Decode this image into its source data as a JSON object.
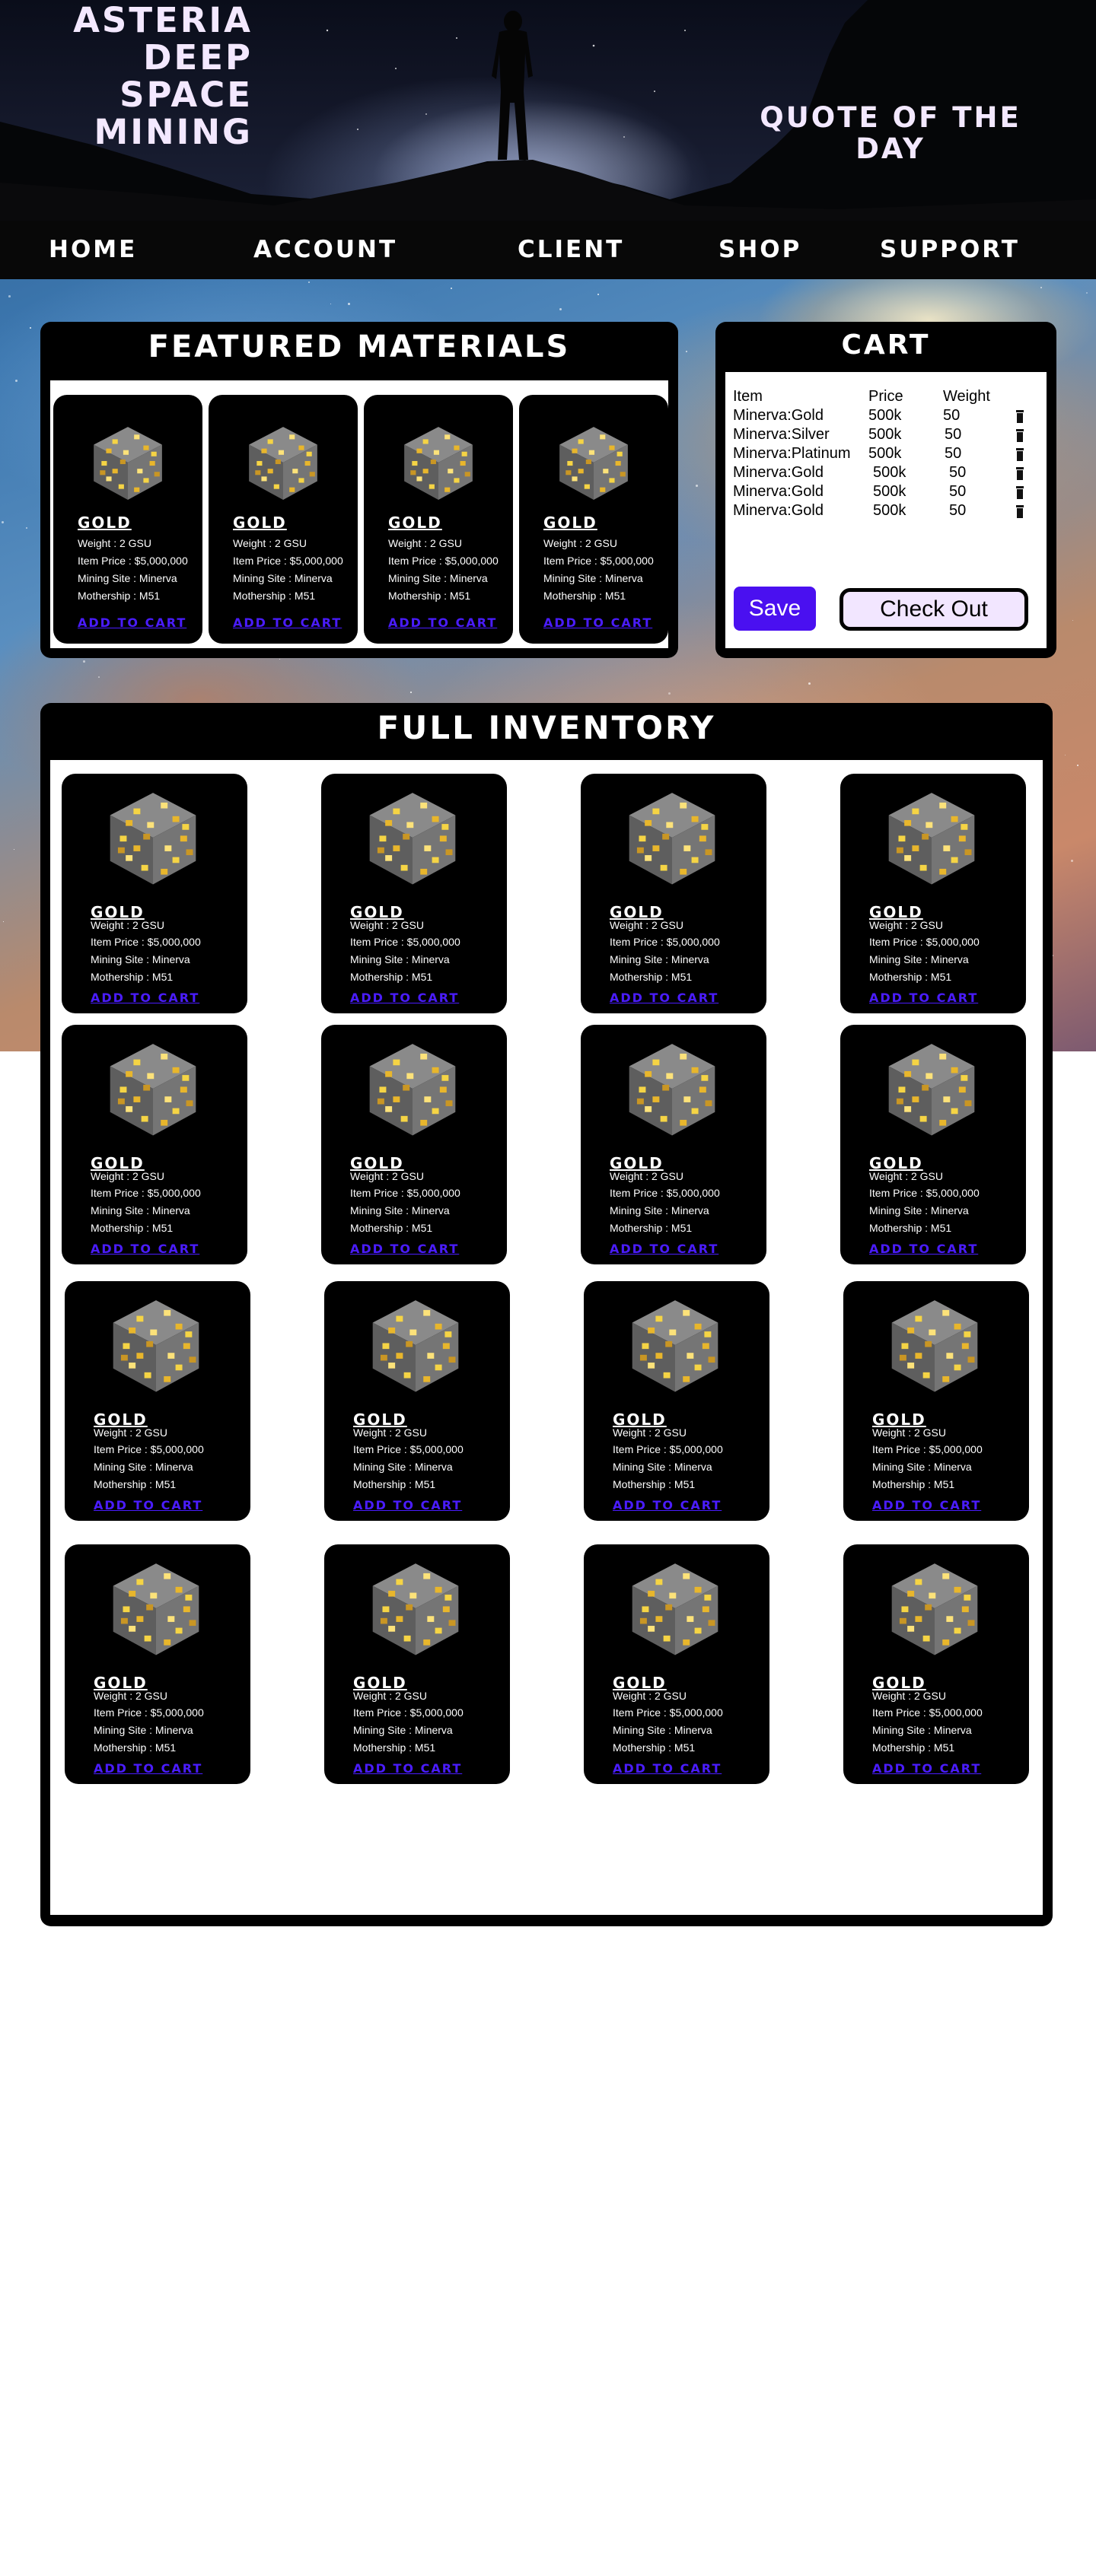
{
  "header": {
    "brand_lines": [
      "ASTERIA",
      "DEEP",
      "SPACE",
      "MINING"
    ],
    "quote_lines": [
      "QUOTE OF THE",
      "DAY"
    ]
  },
  "nav": {
    "items": [
      "HOME",
      "ACCOUNT",
      "CLIENT",
      "SHOP",
      "SUPPORT"
    ]
  },
  "featured": {
    "title": "FEATURED MATERIALS",
    "items": [
      {
        "name": "GOLD",
        "weight": "Weight :  2 GSU",
        "price": "Item Price : $5,000,000",
        "site": "Mining Site :   Minerva",
        "mothership": "Mothership :   M51",
        "action": "ADD TO CART"
      },
      {
        "name": "GOLD",
        "weight": "Weight :  2 GSU",
        "price": "Item Price : $5,000,000",
        "site": "Mining Site :   Minerva",
        "mothership": "Mothership :   M51",
        "action": "ADD TO CART"
      },
      {
        "name": "GOLD",
        "weight": "Weight :  2 GSU",
        "price": "Item Price : $5,000,000",
        "site": "Mining Site :   Minerva",
        "mothership": "Mothership :   M51",
        "action": "ADD TO CART"
      },
      {
        "name": "GOLD",
        "weight": "Weight :  2 GSU",
        "price": "Item Price : $5,000,000",
        "site": "Mining Site :   Minerva",
        "mothership": "Mothership :   M51",
        "action": "ADD TO CART"
      }
    ]
  },
  "cart": {
    "title": "CART",
    "headers": {
      "item": "Item",
      "price": "Price",
      "weight": "Weight"
    },
    "rows": [
      {
        "item": "Minerva:Gold",
        "price": "500k",
        "weight": "50"
      },
      {
        "item": "Minerva:Silver",
        "price": "500k",
        "weight": "50"
      },
      {
        "item": "Minerva:Platinum",
        "price": "500k",
        "weight": "50"
      },
      {
        "item": "Minerva:Gold",
        "price": "500k",
        "weight": "50"
      },
      {
        "item": "Minerva:Gold",
        "price": "500k",
        "weight": "50"
      },
      {
        "item": "Minerva:Gold",
        "price": "500k",
        "weight": "50"
      }
    ],
    "save_label": "Save",
    "checkout_label": "Check Out"
  },
  "inventory": {
    "title": "FULL INVENTORY",
    "item": {
      "name": "GOLD",
      "weight": "Weight :  2 GSU",
      "price": "Item Price : $5,000,000",
      "site": "Mining Site : Minerva",
      "mothership": "Mothership :  M51",
      "action": "ADD TO CART"
    },
    "count": 16
  },
  "colors": {
    "link": "#4a1cff",
    "save_button": "#4a10f0",
    "checkout_button": "#f2e6ff",
    "header_text": "#f3e8ff"
  }
}
